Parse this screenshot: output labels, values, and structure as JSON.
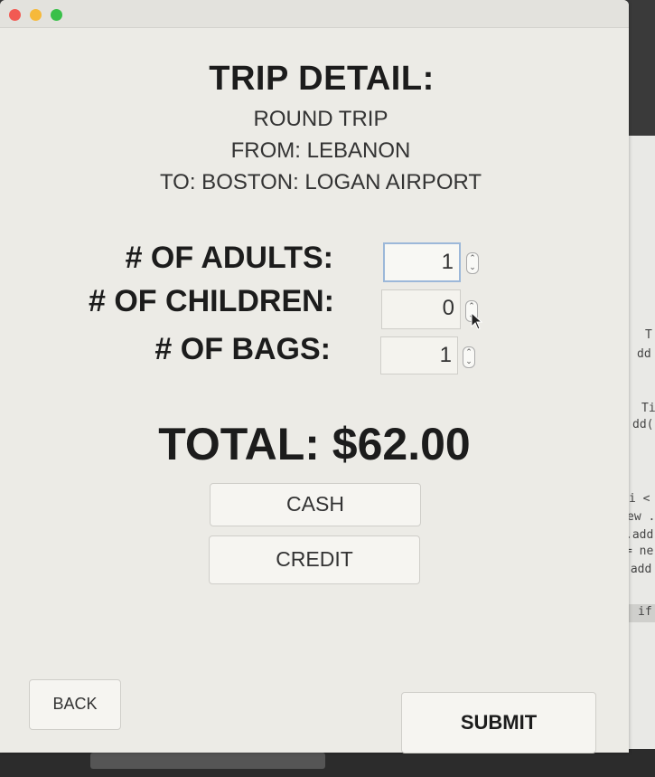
{
  "window": {
    "controls": [
      "close",
      "minimize",
      "maximize"
    ]
  },
  "trip": {
    "heading": "TRIP DETAIL:",
    "type": "ROUND TRIP",
    "from": "FROM: LEBANON",
    "to": "TO: BOSTON: LOGAN AIRPORT"
  },
  "form": {
    "adults_label": "# OF ADULTS:",
    "adults_value": "1",
    "children_label": "# OF CHILDREN:",
    "children_value": "0",
    "bags_label": "# OF BAGS:",
    "bags_value": "1"
  },
  "total": "TOTAL: $62.00",
  "payment": {
    "cash_label": "CASH",
    "credit_label": "CREDIT"
  },
  "nav": {
    "back_label": "BACK",
    "submit_label": "SUBMIT"
  },
  "background_editor": {
    "lines": [
      "<",
      "T",
      "dd",
      "<",
      "Ti",
      "dd(",
      "i <",
      "ew .",
      ".add",
      "= ne",
      ".add",
      "if"
    ]
  },
  "colors": {
    "window_bg": "#ecebe6",
    "close": "#f25a53",
    "minimize": "#f6b93a",
    "maximize": "#39c049",
    "focus_ring": "#9cb8d9"
  },
  "icons": {
    "stepper": "up-down-stepper-icon",
    "cursor": "mouse-pointer-icon"
  }
}
